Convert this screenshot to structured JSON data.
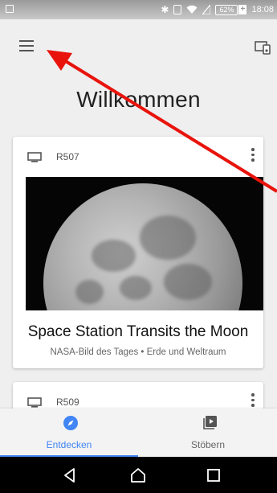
{
  "statusbar": {
    "battery_percent": "62%",
    "battery_plus": "+",
    "time": "18:08"
  },
  "app": {
    "title": "Willkommen"
  },
  "cards": [
    {
      "device": "R507",
      "title": "Space Station Transits the Moon",
      "subtitle": "NASA-Bild des Tages • Erde und Weltraum"
    },
    {
      "device": "R509"
    }
  ],
  "bottom_nav": {
    "discover": "Entdecken",
    "browse": "Stöbern"
  },
  "colors": {
    "accent": "#4285f4",
    "annotation_arrow": "#e8140c"
  }
}
